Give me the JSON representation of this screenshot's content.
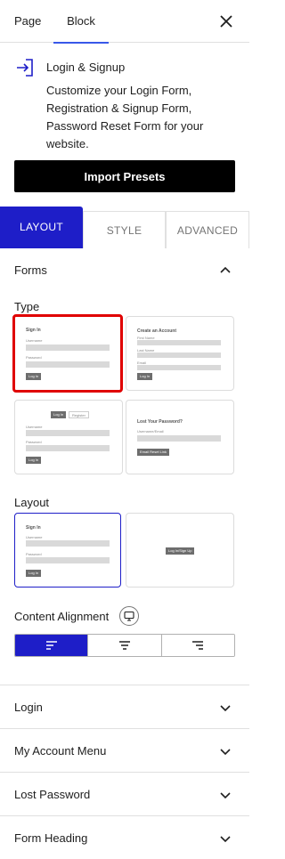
{
  "tabs": {
    "page": "Page",
    "block": "Block"
  },
  "block": {
    "title": "Login & Signup",
    "description": "Customize your Login Form, Registration & Signup Form, Password Reset Form for your website."
  },
  "import_button": "Import Presets",
  "section_tabs": {
    "layout": "LAYOUT",
    "style": "STYLE",
    "advanced": "ADVANCED"
  },
  "forms_panel": {
    "title": "Forms",
    "type_label": "Type",
    "types": [
      {
        "heading": "Sign In",
        "fields": [
          "Username",
          "Password"
        ],
        "button": "Log In"
      },
      {
        "heading": "Create an Account",
        "fields": [
          "First Name",
          "Last Name",
          "Email"
        ],
        "button": "Log In"
      },
      {
        "tabs": [
          "Log In",
          "Register"
        ],
        "fields": [
          "Username",
          "Password"
        ],
        "button": "Log In"
      },
      {
        "heading": "Lost Your Password?",
        "fields": [
          "Username/Email"
        ],
        "button": "Email Reset Link"
      }
    ],
    "layout_label": "Layout",
    "layouts": [
      {
        "heading": "Sign In",
        "fields": [
          "Username",
          "Password"
        ],
        "button": "Log In"
      },
      {
        "button": "Log In/Sign Up"
      }
    ],
    "alignment_label": "Content Alignment"
  },
  "collapsed_panels": [
    "Login",
    "My Account Menu",
    "Lost Password",
    "Form Heading"
  ],
  "colors": {
    "accent": "#1e1ec8",
    "selected_outline": "#e00000"
  }
}
